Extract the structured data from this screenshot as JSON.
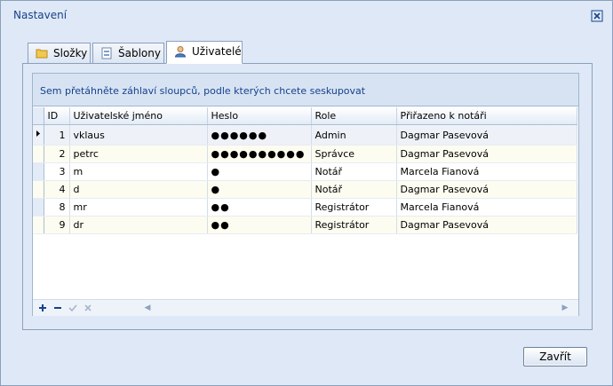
{
  "window": {
    "title": "Nastavení"
  },
  "tabs": [
    {
      "label": "Složky",
      "icon": "folder-icon"
    },
    {
      "label": "Šablony",
      "icon": "template-icon"
    },
    {
      "label": "Uživatelé",
      "icon": "user-icon"
    }
  ],
  "group_panel_text": "Sem přetáhněte záhlaví sloupců, podle kterých chcete seskupovat",
  "columns": [
    "ID",
    "Uživatelské jméno",
    "Heslo",
    "Role",
    "Přiřazeno k notáři"
  ],
  "rows": [
    {
      "id": "1",
      "user": "vklaus",
      "pw": "●●●●●●",
      "role": "Admin",
      "notary": "Dagmar Pasevová"
    },
    {
      "id": "2",
      "user": "petrc",
      "pw": "●●●●●●●●●●",
      "role": "Správce",
      "notary": "Dagmar Pasevová"
    },
    {
      "id": "3",
      "user": "m",
      "pw": "●",
      "role": "Notář",
      "notary": "Marcela Fianová"
    },
    {
      "id": "4",
      "user": "d",
      "pw": "●",
      "role": "Notář",
      "notary": "Dagmar Pasevová"
    },
    {
      "id": "8",
      "user": "mr",
      "pw": "●●",
      "role": "Registrátor",
      "notary": "Marcela Fianová"
    },
    {
      "id": "9",
      "user": "dr",
      "pw": "●●",
      "role": "Registrátor",
      "notary": "Dagmar Pasevová"
    }
  ],
  "close_button_label": "Zavřít"
}
